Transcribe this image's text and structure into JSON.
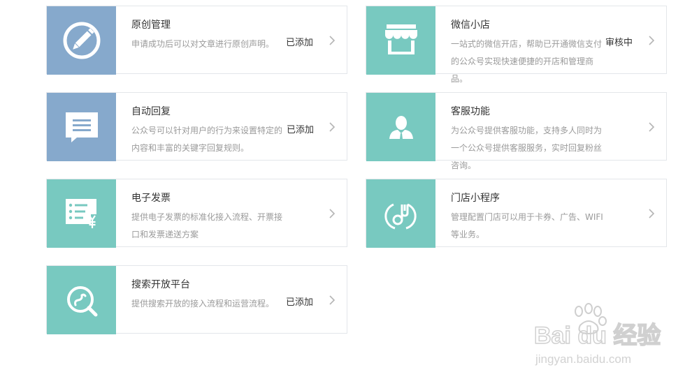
{
  "cards": [
    {
      "title": "原创管理",
      "desc": "申请成功后可以对文章进行原创声明。",
      "status": "已添加",
      "icon": "pencil-icon",
      "color": "#86a9cc"
    },
    {
      "title": "微信小店",
      "desc": "一站式的微信开店，帮助已开通微信支付的公众号实现快速便捷的开店和管理商品。",
      "status": "审核中",
      "icon": "shop-icon",
      "color": "#78c9c0"
    },
    {
      "title": "自动回复",
      "desc": "公众号可以针对用户的行为来设置特定的内容和丰富的关键字回复规则。",
      "status": "已添加",
      "icon": "message-icon",
      "color": "#86a9cc"
    },
    {
      "title": "客服功能",
      "desc": "为公众号提供客服功能，支持多人同时为一个公众号提供客服服务，实时回复粉丝咨询。",
      "status": "",
      "icon": "customer-service-icon",
      "color": "#78c9c0"
    },
    {
      "title": "电子发票",
      "desc": "提供电子发票的标准化接入流程、开票接口和发票递送方案",
      "status": "",
      "icon": "invoice-icon",
      "color": "#78c9c0"
    },
    {
      "title": "门店小程序",
      "desc": "管理配置门店可以用于卡券、广告、WIFI等业务。",
      "status": "",
      "icon": "store-miniprogram-icon",
      "color": "#78c9c0"
    },
    {
      "title": "搜索开放平台",
      "desc": "提供搜索开放的接入流程和运营流程。",
      "status": "已添加",
      "icon": "search-platform-icon",
      "color": "#78c9c0"
    }
  ],
  "watermark": {
    "brand": "Bai du 经验",
    "url": "jingyan.baidu.com"
  }
}
